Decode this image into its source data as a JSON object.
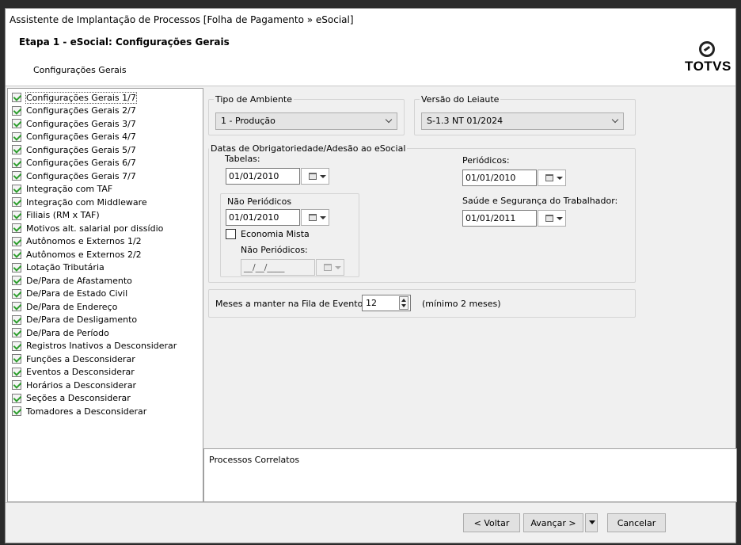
{
  "window": {
    "title": "Assistente de Implantação de Processos [Folha de Pagamento » eSocial]"
  },
  "header": {
    "step_title": "Etapa 1 - eSocial: Configurações Gerais",
    "step_subtitle": "Configurações Gerais",
    "logo_text": "TOTVS"
  },
  "tree": {
    "items": [
      "Configurações Gerais 1/7",
      "Configurações Gerais 2/7",
      "Configurações Gerais 3/7",
      "Configurações Gerais 4/7",
      "Configurações Gerais 5/7",
      "Configurações Gerais 6/7",
      "Configurações Gerais 7/7",
      "Integração com TAF",
      "Integração com Middleware",
      "Filiais (RM x TAF)",
      "Motivos alt. salarial por dissídio",
      "Autônomos e Externos 1/2",
      "Autônomos e Externos 2/2",
      "Lotação Tributária",
      "De/Para de Afastamento",
      "De/Para de Estado Civil",
      "De/Para de Endereço",
      "De/Para de Desligamento",
      "De/Para de Período",
      "Registros Inativos a Desconsiderar",
      "Funções a Desconsiderar",
      "Eventos a Desconsiderar",
      "Horários a Desconsiderar",
      "Seções a Desconsiderar",
      "Tomadores a Desconsiderar"
    ]
  },
  "form": {
    "ambiente": {
      "label": "Tipo de Ambiente",
      "value": "1 - Produção"
    },
    "leiaute": {
      "label": "Versão do Leiaute",
      "value": "S-1.3 NT 01/2024"
    },
    "datas": {
      "label": "Datas de Obrigatoriedade/Adesão ao eSocial",
      "tabelas_label": "Tabelas:",
      "tabelas_value": "01/01/2010",
      "periodicos_label": "Periódicos:",
      "periodicos_value": "01/01/2010",
      "nao_periodicos_group": "Não Periódicos",
      "nao_periodicos_value": "01/01/2010",
      "economia_mista_label": "Economia Mista",
      "nao_periodicos_em_label": "Não Periódicos:",
      "nao_periodicos_em_value": "__/__/____",
      "sst_label": "Saúde e Segurança do Trabalhador:",
      "sst_value": "01/01/2011"
    },
    "fila": {
      "label": "Meses a manter na Fila de Eventos:",
      "value": "12",
      "hint": "(mínimo 2 meses)"
    }
  },
  "related": {
    "label": "Processos Correlatos"
  },
  "buttons": {
    "back": "< Voltar",
    "next": "Avançar >",
    "cancel": "Cancelar"
  }
}
